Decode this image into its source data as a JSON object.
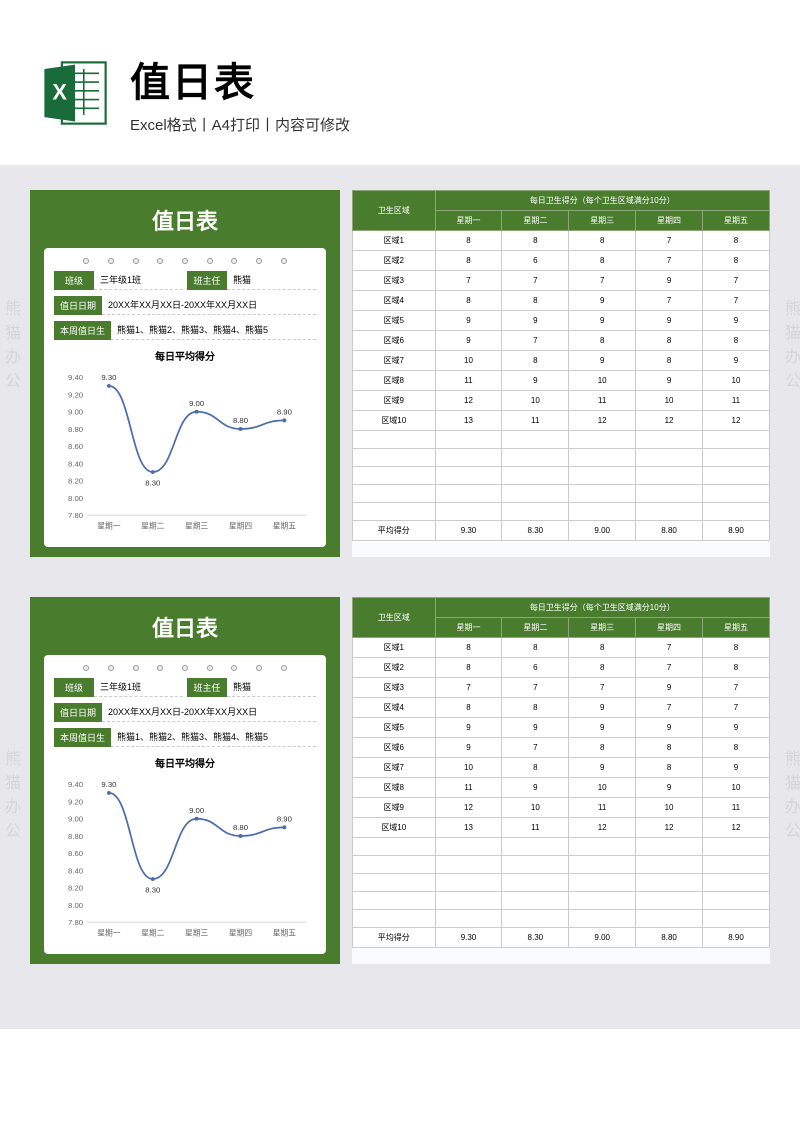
{
  "header": {
    "title": "值日表",
    "subtitle": "Excel格式丨A4打印丨内容可修改"
  },
  "panel": {
    "title": "值日表",
    "class_label": "班级",
    "class_value": "三年级1班",
    "teacher_label": "班主任",
    "teacher_value": "熊猫",
    "date_label": "值日日期",
    "date_value": "20XX年XX月XX日-20XX年XX月XX日",
    "duty_label": "本周值日生",
    "duty_value": "熊猫1、熊猫2、熊猫3、熊猫4、熊猫5"
  },
  "chart_data": {
    "type": "line",
    "title": "每日平均得分",
    "categories": [
      "星期一",
      "星期二",
      "星期三",
      "星期四",
      "星期五"
    ],
    "values": [
      9.3,
      8.3,
      9.0,
      8.8,
      8.9
    ],
    "ylim": [
      7.8,
      9.4
    ],
    "yticks": [
      7.8,
      8.0,
      8.2,
      8.4,
      8.6,
      8.8,
      9.0,
      9.2,
      9.4
    ],
    "xlabel": "",
    "ylabel": ""
  },
  "score_table": {
    "region_header": "卫生区域",
    "score_header": "每日卫生得分（每个卫生区域满分10分）",
    "days": [
      "星期一",
      "星期二",
      "星期三",
      "星期四",
      "星期五"
    ],
    "rows": [
      {
        "region": "区域1",
        "scores": [
          8,
          8,
          8,
          7,
          8
        ]
      },
      {
        "region": "区域2",
        "scores": [
          8,
          6,
          8,
          7,
          8
        ]
      },
      {
        "region": "区域3",
        "scores": [
          7,
          7,
          7,
          9,
          7
        ]
      },
      {
        "region": "区域4",
        "scores": [
          8,
          8,
          9,
          7,
          7
        ]
      },
      {
        "region": "区域5",
        "scores": [
          9,
          9,
          9,
          9,
          9
        ]
      },
      {
        "region": "区域6",
        "scores": [
          9,
          7,
          8,
          8,
          8
        ]
      },
      {
        "region": "区域7",
        "scores": [
          10,
          8,
          9,
          8,
          9
        ]
      },
      {
        "region": "区域8",
        "scores": [
          11,
          9,
          10,
          9,
          10
        ]
      },
      {
        "region": "区域9",
        "scores": [
          12,
          10,
          11,
          10,
          11
        ]
      },
      {
        "region": "区域10",
        "scores": [
          13,
          11,
          12,
          12,
          12
        ]
      }
    ],
    "empty_rows": 5,
    "avg_label": "平均得分",
    "avg": [
      "9.30",
      "8.30",
      "9.00",
      "8.80",
      "8.90"
    ]
  },
  "watermark": "熊猫办公"
}
